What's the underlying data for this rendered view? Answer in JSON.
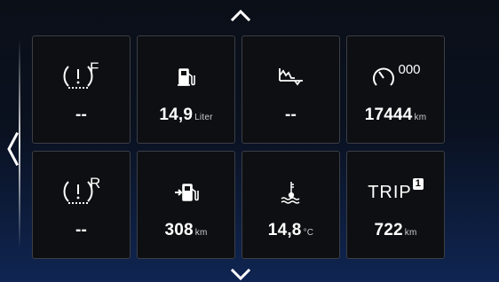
{
  "tiles": [
    {
      "id": "tire-front",
      "letter": "F",
      "value": "--",
      "unit": "",
      "icon": "tire-pressure-icon"
    },
    {
      "id": "fuel",
      "value": "14,9",
      "unit": "Liter",
      "icon": "fuel-pump-icon"
    },
    {
      "id": "road-graph",
      "value": "--",
      "unit": "",
      "icon": "road-profile-icon"
    },
    {
      "id": "odometer",
      "sup": "000",
      "value": "17444",
      "unit": "km",
      "icon": "odometer-icon"
    },
    {
      "id": "tire-rear",
      "letter": "R",
      "value": "--",
      "unit": "",
      "icon": "tire-pressure-icon"
    },
    {
      "id": "range",
      "value": "308",
      "unit": "km",
      "icon": "fuel-range-icon"
    },
    {
      "id": "coolant",
      "value": "14,8",
      "unit": "°C",
      "icon": "coolant-temperature-icon"
    },
    {
      "id": "trip",
      "label": "TRIP",
      "badge": "1",
      "value": "722",
      "unit": "km",
      "icon": "trip-icon"
    }
  ],
  "nav": {
    "up": "chevron-up-icon",
    "down": "chevron-down-icon",
    "left": "chevron-left-icon"
  }
}
